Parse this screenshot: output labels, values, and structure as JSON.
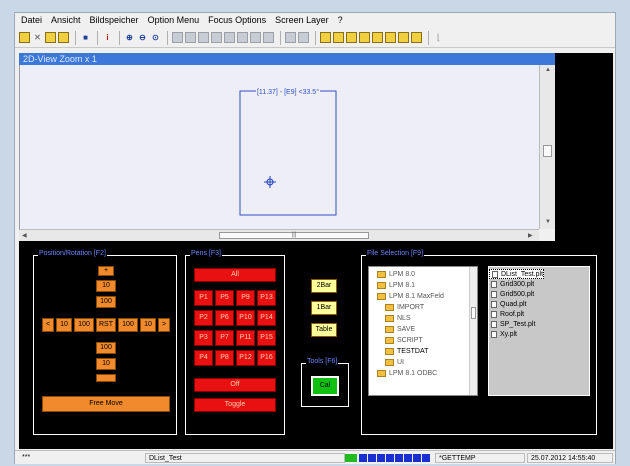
{
  "menu": [
    "Datei",
    "Ansicht",
    "Bildspeicher",
    "Option Menu",
    "Focus Options",
    "Screen Layer",
    "?"
  ],
  "view": {
    "title": "2D-View   Zoom x 1",
    "label": "[11.37] - [E9] <33.5°"
  },
  "position": {
    "title": "Position/Rotation [F2]",
    "arrow_up": "+",
    "v1": "10",
    "v2": "100",
    "left": "<",
    "h1": "10",
    "h2": "100",
    "rst": "RST",
    "h3": "100",
    "h4": "10",
    "right": ">",
    "v3": "100",
    "v4": "10",
    "free_move": "Free Move"
  },
  "pens": {
    "title": "Pens [F3]",
    "all": "All",
    "grid": [
      "P1",
      "P5",
      "P9",
      "P13",
      "P2",
      "P6",
      "P10",
      "P14",
      "P3",
      "P7",
      "P11",
      "P15",
      "P4",
      "P8",
      "P12",
      "P16"
    ],
    "off": "Off",
    "toggle": "Toggle"
  },
  "bars": [
    "2Bar",
    "1Bar",
    "Table"
  ],
  "tools": {
    "title": "Tools [F6]",
    "cal": "Cal"
  },
  "files": {
    "title": "File Selection [F9]",
    "tree": [
      "LPM 8.0",
      "LPM 8.1",
      "LPM 8.1 MaxFeld",
      "IMPORT",
      "NLS",
      "SAVE",
      "SCRIPT",
      "TESTDAT",
      "UI",
      "LPM 8.1 ODBC"
    ],
    "list": [
      "DList_Test.plt",
      "Grid300.plt",
      "Grid500.plt",
      "Quad.plt",
      "Roof.plt",
      "SP_Test.plt",
      "Xy.plt"
    ]
  },
  "status": {
    "left": "***",
    "file": "DList_Test",
    "var": "*GETTEMP",
    "datetime": "25.07.2012 14:55:40"
  },
  "colors": {
    "accent": "#3c78d8",
    "orange": "#f08a2c",
    "red": "#e81010"
  }
}
